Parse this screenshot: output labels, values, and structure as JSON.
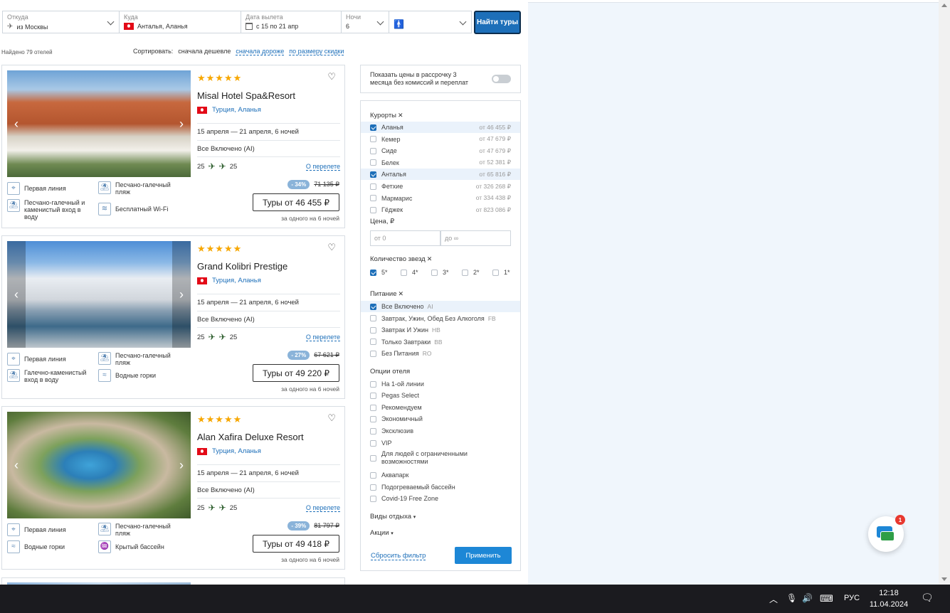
{
  "search": {
    "from_label": "Откуда",
    "from_value": "из Москвы",
    "to_label": "Куда",
    "to_value": "Анталья, Аланья",
    "date_label": "Дата вылета",
    "date_value": "с 15 по 21 апр",
    "nights_label": "Ночи",
    "nights_value": "6",
    "find_button": "Найти туры"
  },
  "results": {
    "found": "Найдено 79 отелей",
    "sort_label": "Сортировать:",
    "sort_cheap": "сначала дешевле",
    "sort_expensive": "сначала дороже",
    "sort_discount": "по размеру скидки"
  },
  "hotels": [
    {
      "stars": "★★★★★",
      "name": "Misal Hotel Spa&Resort",
      "location": "Турция, Аланья",
      "dates": "15 апреля — 21 апреля, 6 ночей",
      "meal": "Все Включено (AI)",
      "flight_out": "25",
      "flight_back": "25",
      "flight_link": "О перелете",
      "features": [
        "Первая линия",
        "Песчано-галечный пляж",
        "Песчано-галечный и каменистый вход в воду",
        "Бесплатный Wi-Fi"
      ],
      "discount": "- 34%",
      "old_price": "71 135 ₽",
      "price_button": "Туры от 46 455 ₽",
      "per_one": "за одного на 6 ночей"
    },
    {
      "stars": "★★★★★",
      "name": "Grand Kolibri Prestige",
      "location": "Турция, Аланья",
      "dates": "15 апреля — 21 апреля, 6 ночей",
      "meal": "Все Включено (AI)",
      "flight_out": "25",
      "flight_back": "25",
      "flight_link": "О перелете",
      "features": [
        "Первая линия",
        "Песчано-галечный пляж",
        "Галечно-каменистый вход в воду",
        "Водные горки"
      ],
      "discount": "- 27%",
      "old_price": "67 621 ₽",
      "price_button": "Туры от 49 220 ₽",
      "per_one": "за одного на 6 ночей"
    },
    {
      "stars": "★★★★★",
      "name": "Alan Xafira Deluxe Resort",
      "location": "Турция, Аланья",
      "dates": "15 апреля — 21 апреля, 6 ночей",
      "meal": "Все Включено (AI)",
      "flight_out": "25",
      "flight_back": "25",
      "flight_link": "О перелете",
      "features": [
        "Первая линия",
        "Песчано-галечный пляж",
        "Водные горки",
        "Крытый бассейн"
      ],
      "discount": "- 39%",
      "old_price": "81 797 ₽",
      "price_button": "Туры от 49 418 ₽",
      "per_one": "за одного на 6 ночей"
    }
  ],
  "installment": "Показать цены в рассрочку 3 месяца без комиссий и переплат",
  "filters": {
    "resorts_title": "Курорты",
    "resorts": [
      {
        "name": "Аланья",
        "price": "от 46 455 ₽",
        "checked": true
      },
      {
        "name": "Кемер",
        "price": "от 47 679 ₽",
        "checked": false
      },
      {
        "name": "Сиде",
        "price": "от 47 679 ₽",
        "checked": false
      },
      {
        "name": "Белек",
        "price": "от 52 381 ₽",
        "checked": false
      },
      {
        "name": "Анталья",
        "price": "от 65 816 ₽",
        "checked": true
      },
      {
        "name": "Фетхие",
        "price": "от 326 268 ₽",
        "checked": false
      },
      {
        "name": "Мармарис",
        "price": "от 334 438 ₽",
        "checked": false
      },
      {
        "name": "Гёджек",
        "price": "от 823 086 ₽",
        "checked": false
      }
    ],
    "price_title": "Цена, ₽",
    "price_from": "от  0",
    "price_to": "до  ∞",
    "stars_title": "Количество звезд",
    "stars": [
      {
        "label": "5*",
        "checked": true
      },
      {
        "label": "4*",
        "checked": false
      },
      {
        "label": "3*",
        "checked": false
      },
      {
        "label": "2*",
        "checked": false
      },
      {
        "label": "1*",
        "checked": false
      }
    ],
    "meal_title": "Питание",
    "meals": [
      {
        "name": "Все Включено",
        "code": "AI",
        "checked": true
      },
      {
        "name": "Завтрак, Ужин, Обед Без Алкоголя",
        "code": "FB",
        "checked": false
      },
      {
        "name": "Завтрак И Ужин",
        "code": "HB",
        "checked": false
      },
      {
        "name": "Только Завтраки",
        "code": "BB",
        "checked": false
      },
      {
        "name": "Без Питания",
        "code": "RO",
        "checked": false
      }
    ],
    "options_title": "Опции отеля",
    "options": [
      "На 1-ой линии",
      "Pegas Select",
      "Рекомендуем",
      "Экономичный",
      "Эксклюзив",
      "VIP",
      "Для людей с ограниченными возможностями",
      "Аквапарк",
      "Подогреваемый бассейн",
      "Covid-19 Free Zone"
    ],
    "rest_types": "Виды отдыха",
    "promos": "Акции",
    "reset": "Сбросить фильтр",
    "apply": "Применить"
  },
  "chat_badge": "1",
  "taskbar": {
    "lang": "РУС",
    "time": "12:18",
    "date": "11.04.2024"
  }
}
